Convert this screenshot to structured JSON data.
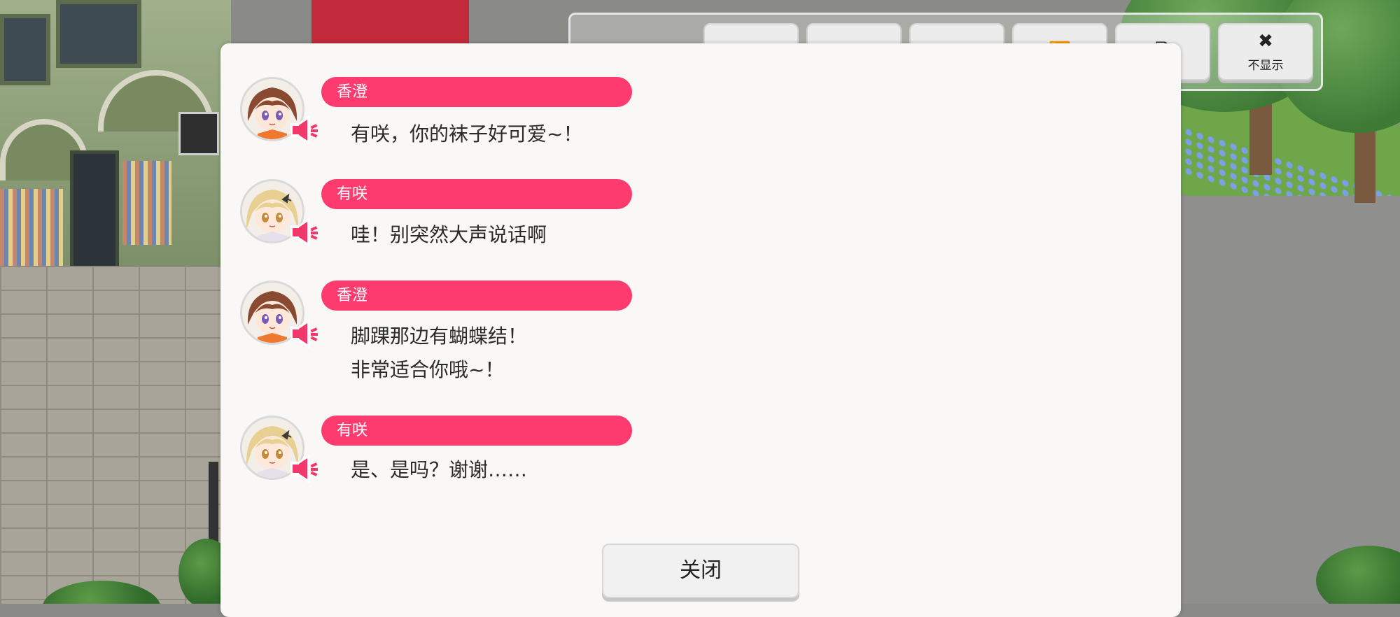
{
  "toolbar": {
    "buttons": [
      {
        "icon": "skip-to-end-icon",
        "glyph": "⏭",
        "label": ""
      },
      {
        "icon": "play-icon",
        "glyph": "▶",
        "label": ""
      },
      {
        "icon": "auto-play-icon",
        "glyph": "[▶]",
        "label": ""
      },
      {
        "icon": "fast-forward-icon",
        "glyph": "⏩",
        "label": ""
      },
      {
        "icon": "log-icon",
        "glyph": "🗎",
        "label": ""
      },
      {
        "icon": "close-x-icon",
        "glyph": "✖",
        "label": "不显示"
      }
    ]
  },
  "dialog": {
    "entries": [
      {
        "speaker": "香澄",
        "avatar": "kasumi-avatar",
        "lines": [
          "有咲，你的袜子好可爱~！"
        ]
      },
      {
        "speaker": "有咲",
        "avatar": "arisa-avatar",
        "lines": [
          "哇！别突然大声说话啊"
        ]
      },
      {
        "speaker": "香澄",
        "avatar": "kasumi-avatar",
        "lines": [
          "脚踝那边有蝴蝶结！",
          "非常适合你哦~！"
        ]
      },
      {
        "speaker": "有咲",
        "avatar": "arisa-avatar",
        "lines": [
          "是、是吗？谢谢……"
        ]
      }
    ],
    "close_label": "关闭"
  },
  "colors": {
    "name_pill": "#fe3b6e",
    "speaker_icon": "#f2386b",
    "dialog_bg": "#f9f8f6"
  }
}
